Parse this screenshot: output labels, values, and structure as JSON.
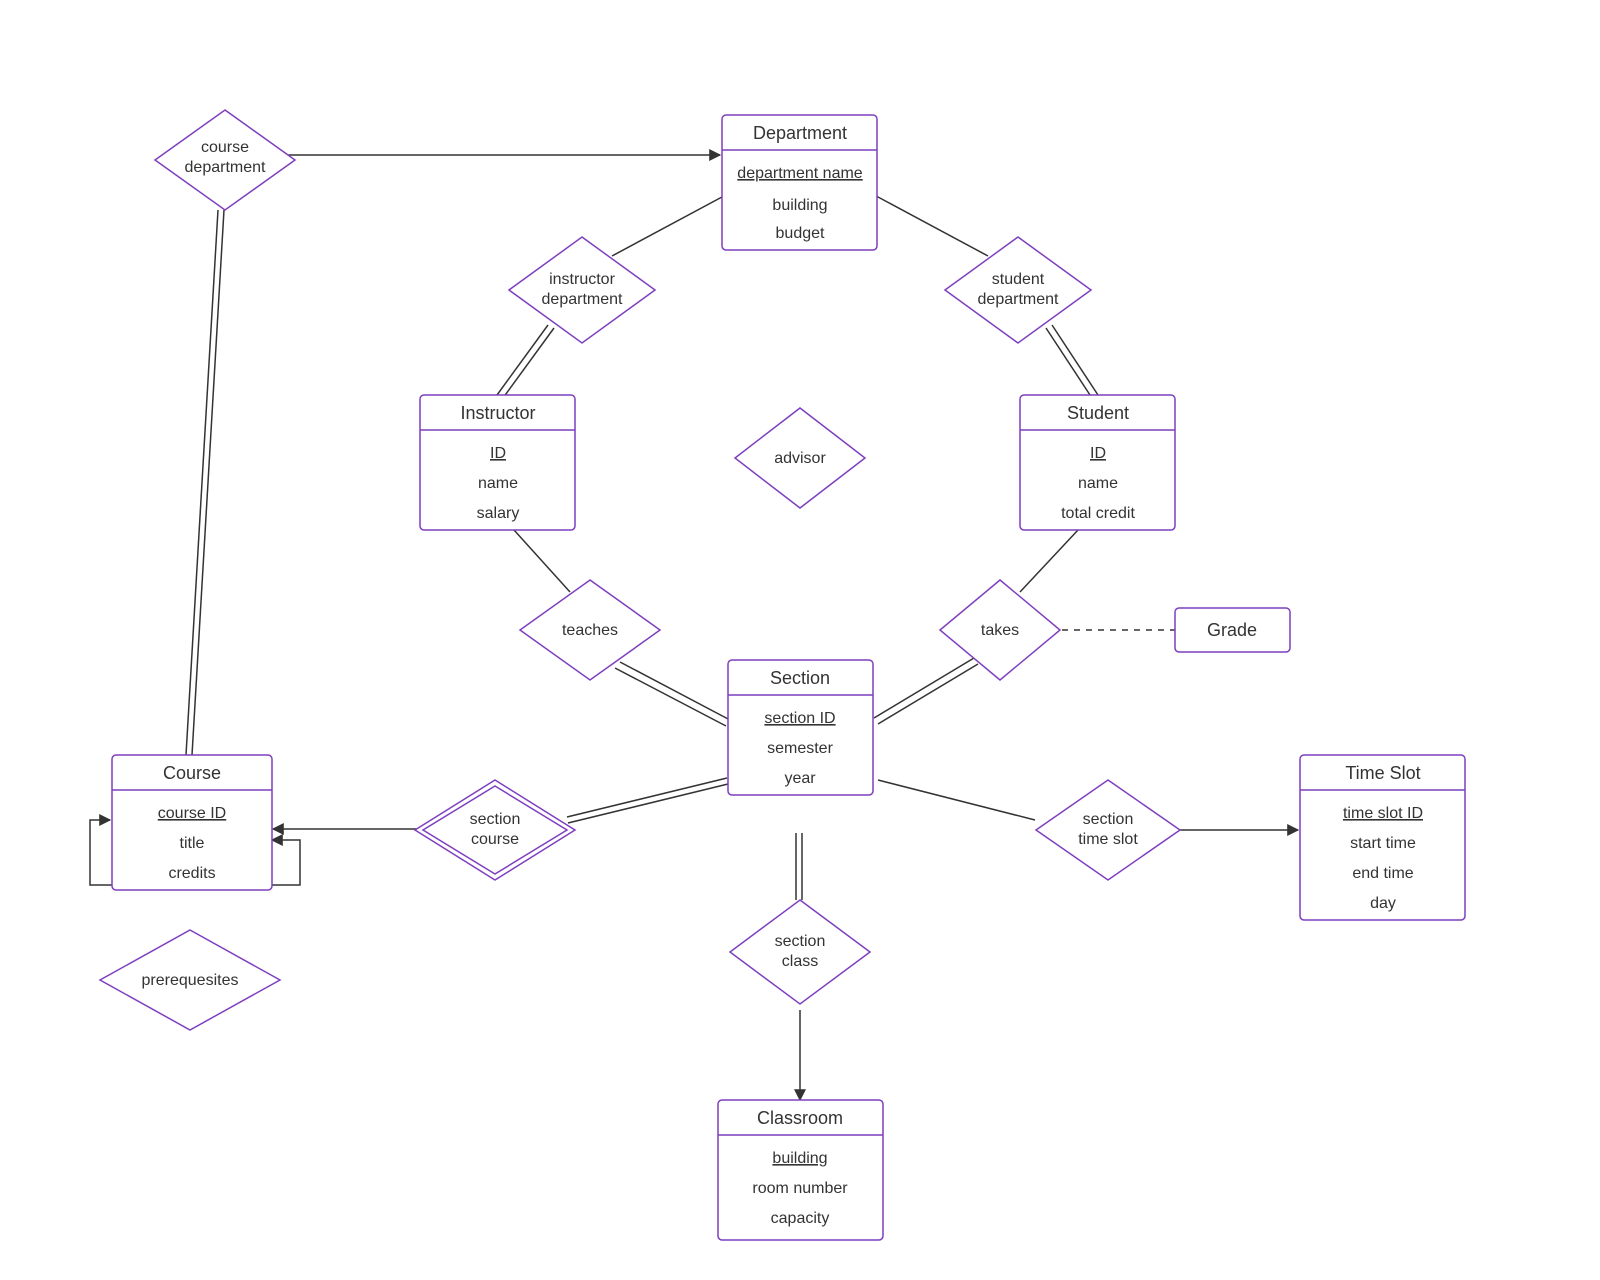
{
  "entities": {
    "department": {
      "title": "Department",
      "key": "department name",
      "attrs": [
        "building",
        "budget"
      ]
    },
    "instructor": {
      "title": "Instructor",
      "key": "ID",
      "attrs": [
        "name",
        "salary"
      ]
    },
    "student": {
      "title": "Student",
      "key": "ID",
      "attrs": [
        "name",
        "total credit"
      ]
    },
    "section": {
      "title": "Section",
      "key": "section ID",
      "attrs": [
        "semester",
        "year"
      ]
    },
    "course": {
      "title": "Course",
      "key": "course ID",
      "attrs": [
        "title",
        "credits"
      ]
    },
    "timeslot": {
      "title": "Time Slot",
      "key": "time slot ID",
      "attrs": [
        "start time",
        "end time",
        "day"
      ]
    },
    "classroom": {
      "title": "Classroom",
      "key": "building",
      "attrs": [
        "room number",
        "capacity"
      ]
    },
    "grade": {
      "title": "Grade"
    }
  },
  "relationships": {
    "course_department": {
      "l1": "course",
      "l2": "department"
    },
    "instructor_department": {
      "l1": "instructor",
      "l2": "department"
    },
    "student_department": {
      "l1": "student",
      "l2": "department"
    },
    "advisor": {
      "l1": "advisor"
    },
    "teaches": {
      "l1": "teaches"
    },
    "takes": {
      "l1": "takes"
    },
    "section_course": {
      "l1": "section",
      "l2": "course"
    },
    "section_timeslot": {
      "l1": "section",
      "l2": "time slot"
    },
    "section_class": {
      "l1": "section",
      "l2": "class"
    },
    "prerequisites": {
      "l1": "prerequesites"
    }
  }
}
